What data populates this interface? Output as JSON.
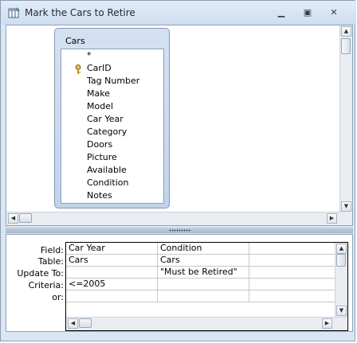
{
  "window": {
    "title": "Mark the Cars to Retire",
    "minimize_icon": "minimize-icon",
    "restore_icon": "restore-icon",
    "close_icon": "close-icon"
  },
  "table_box": {
    "name": "Cars",
    "fields": [
      "*",
      "CarID",
      "Tag Number",
      "Make",
      "Model",
      "Car Year",
      "Category",
      "Doors",
      "Picture",
      "Available",
      "Condition",
      "Notes"
    ],
    "primary_key_field": "CarID"
  },
  "grid": {
    "row_labels": {
      "field": "Field:",
      "table": "Table:",
      "update_to": "Update To:",
      "criteria": "Criteria:",
      "or": "or:"
    },
    "columns": [
      {
        "field": "Car Year",
        "table": "Cars",
        "update_to": "",
        "criteria": "<=2005",
        "or": ""
      },
      {
        "field": "Condition",
        "table": "Cars",
        "update_to": "\"Must be Retired\"",
        "criteria": "",
        "or": ""
      },
      {
        "field": "",
        "table": "",
        "update_to": "",
        "criteria": "",
        "or": ""
      }
    ]
  }
}
